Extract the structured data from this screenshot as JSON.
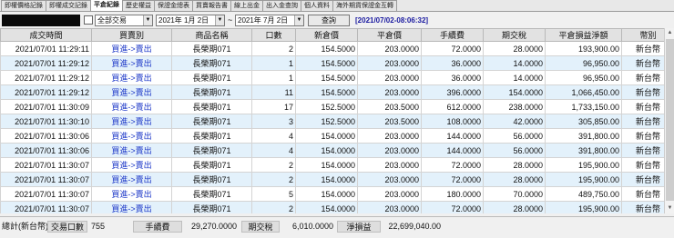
{
  "tabs": [
    {
      "label": "即權價格記錄",
      "active": false
    },
    {
      "label": "即權成交記錄",
      "active": false
    },
    {
      "label": "平倉紀錄",
      "active": true
    },
    {
      "label": "歷史權益",
      "active": false
    },
    {
      "label": "保證金總表",
      "active": false
    },
    {
      "label": "買賣報告書",
      "active": false
    },
    {
      "label": "線上出金",
      "active": false
    },
    {
      "label": "出入金查詢",
      "active": false
    },
    {
      "label": "個人資料",
      "active": false
    },
    {
      "label": "海外期貨保證金互轉",
      "active": false
    }
  ],
  "toolbar": {
    "trade_type": "全部交易",
    "start_date": "2021年 1月 2日",
    "tilde": "~",
    "end_date": "2021年 7月 2日",
    "query_label": "查詢",
    "timestamp": "[2021/07/02-08:06:32]"
  },
  "table": {
    "headers": [
      "成交時間",
      "買賣別",
      "商品名稱",
      "口數",
      "新倉價",
      "平倉價",
      "手續費",
      "期交稅",
      "平倉損益淨額",
      "幣別"
    ],
    "rows": [
      [
        "2021/07/01 11:29:11",
        "買進->賣出",
        "長榮期071",
        "2",
        "154.5000",
        "203.0000",
        "72.0000",
        "28.0000",
        "193,900.00",
        "新台幣"
      ],
      [
        "2021/07/01 11:29:12",
        "買進->賣出",
        "長榮期071",
        "1",
        "154.5000",
        "203.0000",
        "36.0000",
        "14.0000",
        "96,950.00",
        "新台幣"
      ],
      [
        "2021/07/01 11:29:12",
        "買進->賣出",
        "長榮期071",
        "1",
        "154.5000",
        "203.0000",
        "36.0000",
        "14.0000",
        "96,950.00",
        "新台幣"
      ],
      [
        "2021/07/01 11:29:12",
        "買進->賣出",
        "長榮期071",
        "11",
        "154.5000",
        "203.0000",
        "396.0000",
        "154.0000",
        "1,066,450.00",
        "新台幣"
      ],
      [
        "2021/07/01 11:30:09",
        "買進->賣出",
        "長榮期071",
        "17",
        "152.5000",
        "203.5000",
        "612.0000",
        "238.0000",
        "1,733,150.00",
        "新台幣"
      ],
      [
        "2021/07/01 11:30:10",
        "買進->賣出",
        "長榮期071",
        "3",
        "152.5000",
        "203.5000",
        "108.0000",
        "42.0000",
        "305,850.00",
        "新台幣"
      ],
      [
        "2021/07/01 11:30:06",
        "買進->賣出",
        "長榮期071",
        "4",
        "154.0000",
        "203.0000",
        "144.0000",
        "56.0000",
        "391,800.00",
        "新台幣"
      ],
      [
        "2021/07/01 11:30:06",
        "買進->賣出",
        "長榮期071",
        "4",
        "154.0000",
        "203.0000",
        "144.0000",
        "56.0000",
        "391,800.00",
        "新台幣"
      ],
      [
        "2021/07/01 11:30:07",
        "買進->賣出",
        "長榮期071",
        "2",
        "154.0000",
        "203.0000",
        "72.0000",
        "28.0000",
        "195,900.00",
        "新台幣"
      ],
      [
        "2021/07/01 11:30:07",
        "買進->賣出",
        "長榮期071",
        "2",
        "154.0000",
        "203.0000",
        "72.0000",
        "28.0000",
        "195,900.00",
        "新台幣"
      ],
      [
        "2021/07/01 11:30:07",
        "買進->賣出",
        "長榮期071",
        "5",
        "154.0000",
        "203.0000",
        "180.0000",
        "70.0000",
        "489,750.00",
        "新台幣"
      ],
      [
        "2021/07/01 11:30:07",
        "買進->賣出",
        "長榮期071",
        "2",
        "154.0000",
        "203.0000",
        "72.0000",
        "28.0000",
        "195,900.00",
        "新台幣"
      ],
      [
        "2021/07/01 11:30:07",
        "買進->賣出",
        "長榮期071",
        "1",
        "154.0000",
        "203.0000",
        "36.0000",
        "14.0000",
        "97,950.00",
        "新台幣"
      ]
    ]
  },
  "footer": {
    "total_label": "總計(新台幣)",
    "lots_label": "交易口數",
    "lots_value": "755",
    "fee_label": "手續費",
    "fee_value": "29,270.0000",
    "tax_label": "期交稅",
    "tax_value": "6,010.0000",
    "net_label": "淨損益",
    "net_value": "22,699,040.00"
  },
  "colors": {
    "accent_text": "#1d38c8",
    "row_alt": "#e3f1fb",
    "timestamp": "#1a1aa0"
  }
}
